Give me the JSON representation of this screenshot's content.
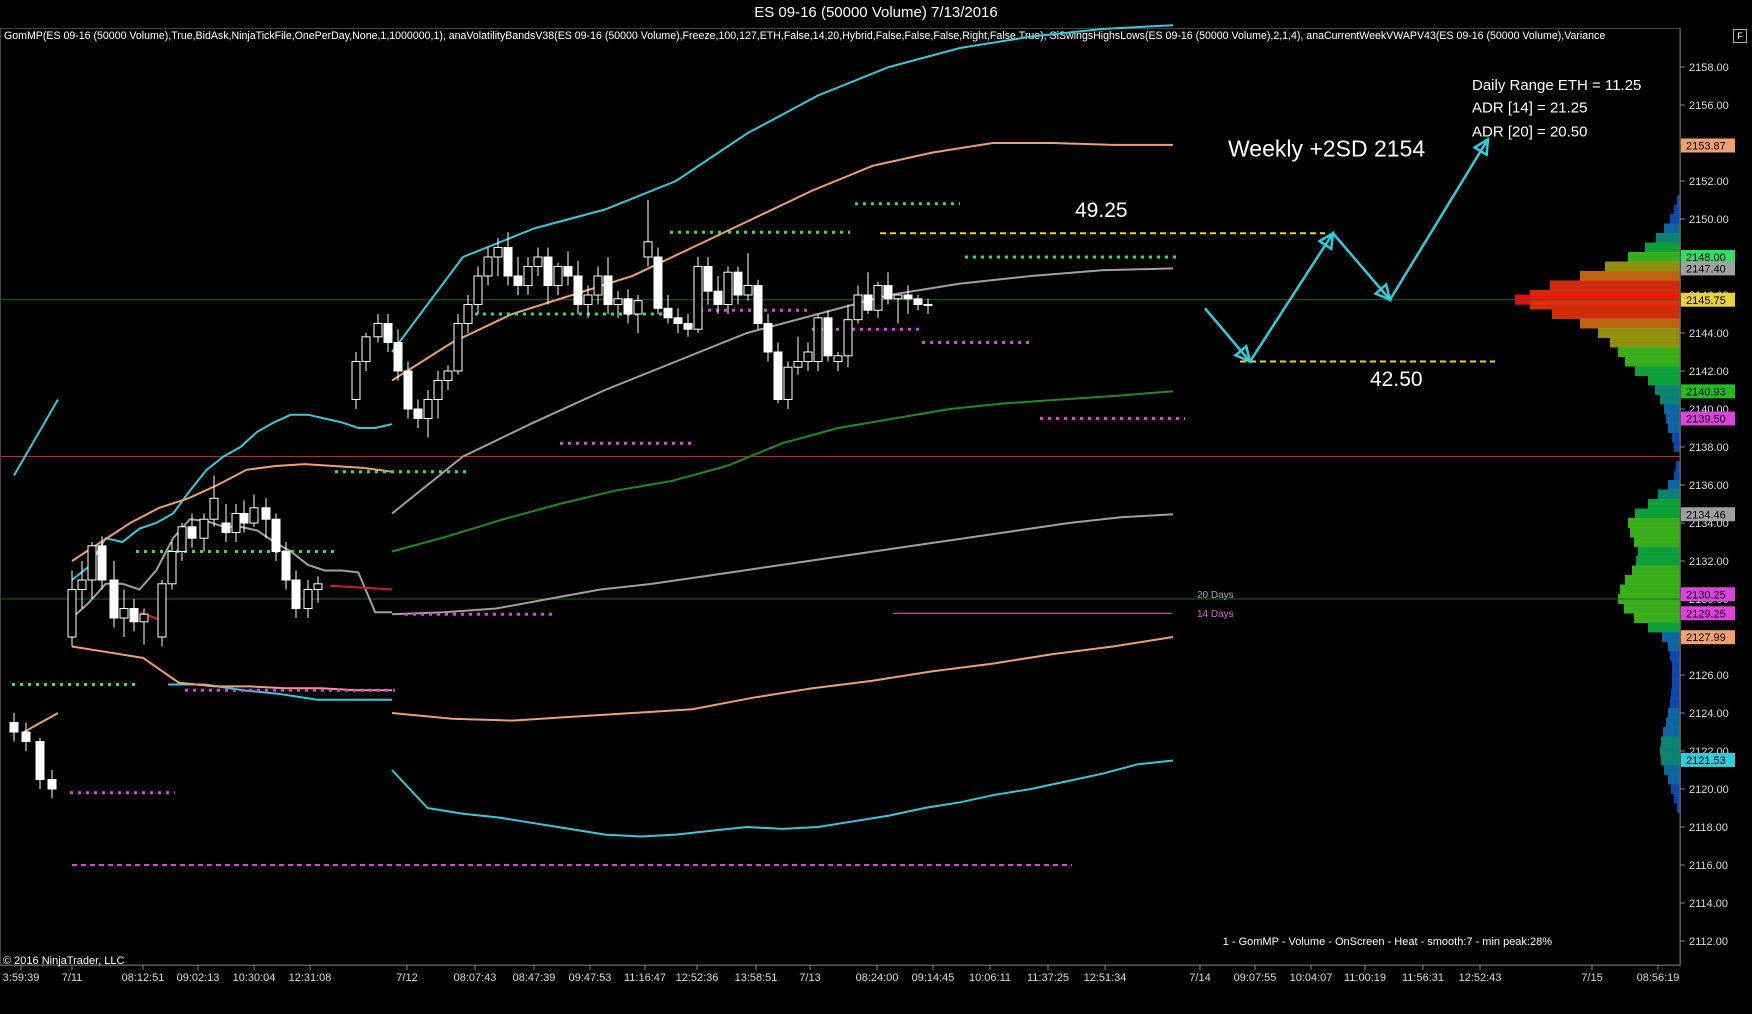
{
  "window": {
    "title": "ES 09-16 (50000 Volume)  7/13/2016"
  },
  "indicator_line": "GomMP(ES 09-16 (50000 Volume),True,BidAsk,NinjaTickFile,OnePerDay,None,1,1000000,1), anaVolatilityBandsV38(ES 09-16 (50000 Volume),Freeze,100,127,ETH,False,14,20,Hybrid,False,False,False,Right,False,True), SiSwingsHighsLows(ES 09-16 (50000 Volume),2,1,4), anaCurrentWeekVWAPV43(ES 09-16 (50000 Volume),Variance",
  "f_button": "F",
  "copyright": "© 2016 NinjaTrader, LLC",
  "footnote": "1 - GomMP - Volume - OnScreen - Heat - smooth:7 - min peak:28%",
  "colors": {
    "bg": "#000000",
    "cyan": "#33ccdd",
    "orange": "#f0a070",
    "gray": "#a0a0a0",
    "green": "#1e8c1e",
    "red_line": "#cc2222",
    "yellow": "#e8d040",
    "magenta": "#dd44dd"
  },
  "chart_data": {
    "type": "candlestick",
    "title": "ES 09-16 (50000 Volume)  7/13/2016",
    "ylim": [
      2111,
      2159.5
    ],
    "y_ticks": [
      "2112.00",
      "2114.00",
      "2116.00",
      "2118.00",
      "2120.00",
      "2122.00",
      "2124.00",
      "2126.00",
      "2128.00",
      "2130.00",
      "2132.00",
      "2134.00",
      "2136.00",
      "2138.00",
      "2140.00",
      "2142.00",
      "2144.00",
      "2146.00",
      "2148.00",
      "2150.00",
      "2152.00",
      "2154.00",
      "2156.00",
      "2158.00"
    ],
    "x_ticks": [
      "3:59:39",
      "7/11",
      "08:12:51",
      "09:02:13",
      "10:30:04",
      "12:31:08",
      "7/12",
      "08:07:43",
      "08:47:39",
      "09:47:53",
      "11:16:47",
      "12:52:36",
      "13:58:51",
      "7/13",
      "08:24:00",
      "09:14:45",
      "10:06:11",
      "11:37:25",
      "12:51:34",
      "7/14",
      "09:07:55",
      "10:04:07",
      "11:00:19",
      "11:56:31",
      "12:52:43",
      "7/15",
      "08:56:19"
    ],
    "price_labels": [
      {
        "text": "2153.87",
        "value": 2153.87,
        "color": "#f0a070"
      },
      {
        "text": "2148.00",
        "value": 2148.0,
        "color": "#33dd66"
      },
      {
        "text": "2147.40",
        "value": 2147.4,
        "color": "#a0a0a0"
      },
      {
        "text": "2145.75",
        "value": 2145.75,
        "color": "#e8d040"
      },
      {
        "text": "2140.93",
        "value": 2140.93,
        "color": "#22bb22"
      },
      {
        "text": "2139.50",
        "value": 2139.5,
        "color": "#dd44dd"
      },
      {
        "text": "2134.46",
        "value": 2134.46,
        "color": "#a0a0a0"
      },
      {
        "text": "2130.25",
        "value": 2130.25,
        "color": "#dd44dd"
      },
      {
        "text": "2129.25",
        "value": 2129.25,
        "color": "#dd44dd"
      },
      {
        "text": "2127.99",
        "value": 2127.99,
        "color": "#f0a070"
      },
      {
        "text": "2121.53",
        "value": 2121.53,
        "color": "#33ccdd"
      }
    ],
    "candles": [
      [
        2123.5,
        2124,
        2122.5,
        2123
      ],
      [
        2123,
        2123.5,
        2122,
        2122.5
      ],
      [
        2122.5,
        2122.7,
        2120,
        2120.5
      ],
      [
        2120.5,
        2121,
        2119.5,
        2120
      ],
      [
        2128,
        2131.5,
        2127.5,
        2130.5
      ],
      [
        2130.5,
        2132,
        2129.5,
        2131
      ],
      [
        2131,
        2133,
        2130,
        2132.8
      ],
      [
        2132.8,
        2133.3,
        2130.5,
        2131
      ],
      [
        2131,
        2132,
        2128.5,
        2129
      ],
      [
        2129,
        2130.5,
        2128,
        2129.5
      ],
      [
        2129.5,
        2130,
        2128.3,
        2128.8
      ],
      [
        2128.8,
        2129.5,
        2127.6,
        2129.2
      ],
      [
        2128,
        2131,
        2127.5,
        2130.8
      ],
      [
        2130.8,
        2133,
        2130.5,
        2132.5
      ],
      [
        2132.5,
        2134,
        2132,
        2133.8
      ],
      [
        2133.8,
        2134.5,
        2132.7,
        2133.2
      ],
      [
        2133.2,
        2134.5,
        2132.5,
        2134.2
      ],
      [
        2134.2,
        2136.5,
        2133.8,
        2135.3
      ],
      [
        2134,
        2135,
        2133,
        2133.5
      ],
      [
        2133.5,
        2135,
        2133,
        2134.5
      ],
      [
        2134.5,
        2135.2,
        2133.5,
        2134
      ],
      [
        2134,
        2135.5,
        2133.8,
        2134.8
      ],
      [
        2134.8,
        2135.3,
        2133.2,
        2134.2
      ],
      [
        2134.2,
        2134.5,
        2132,
        2132.5
      ],
      [
        2132.5,
        2133,
        2130.5,
        2131
      ],
      [
        2131,
        2131.5,
        2129,
        2129.5
      ],
      [
        2129.5,
        2131,
        2129,
        2130.5
      ],
      [
        2130.5,
        2131.2,
        2129.8,
        2130.8
      ],
      [
        2140.5,
        2143,
        2140,
        2142.5
      ],
      [
        2142.5,
        2144,
        2142,
        2143.8
      ],
      [
        2143.8,
        2145,
        2143.5,
        2144.5
      ],
      [
        2144.5,
        2145,
        2143,
        2143.5
      ],
      [
        2143.5,
        2144.2,
        2141.5,
        2142
      ],
      [
        2142,
        2142.5,
        2139.5,
        2140
      ],
      [
        2140,
        2140.5,
        2139,
        2139.5
      ],
      [
        2139.5,
        2141,
        2138.5,
        2140.5
      ],
      [
        2140.5,
        2142,
        2139.5,
        2141.5
      ],
      [
        2141.5,
        2142.3,
        2141,
        2142
      ],
      [
        2142,
        2145,
        2141.8,
        2144.5
      ],
      [
        2144.5,
        2146,
        2144,
        2145.5
      ],
      [
        2145.5,
        2147.5,
        2145,
        2147
      ],
      [
        2147,
        2148.5,
        2146.5,
        2148
      ],
      [
        2148,
        2149,
        2147,
        2148.5
      ],
      [
        2148.5,
        2149.3,
        2146.5,
        2147
      ],
      [
        2147,
        2148,
        2146,
        2146.5
      ],
      [
        2146.5,
        2148,
        2146,
        2147.5
      ],
      [
        2147.5,
        2148.5,
        2147,
        2148
      ],
      [
        2148,
        2148.5,
        2145.5,
        2146.5
      ],
      [
        2146.5,
        2147.7,
        2146,
        2147.5
      ],
      [
        2147.5,
        2148.3,
        2146.5,
        2147
      ],
      [
        2147,
        2147.8,
        2145,
        2145.5
      ],
      [
        2145.5,
        2146.5,
        2144.8,
        2146
      ],
      [
        2146,
        2147.5,
        2145.5,
        2147
      ],
      [
        2147,
        2148,
        2145,
        2145.5
      ],
      [
        2145.5,
        2146.2,
        2144.8,
        2145.8
      ],
      [
        2145.8,
        2146.3,
        2144.5,
        2145
      ],
      [
        2145,
        2146,
        2144,
        2145.7
      ],
      [
        2148,
        2151,
        2147.5,
        2148.8
      ],
      [
        2148,
        2148.5,
        2145,
        2145.3
      ],
      [
        2145.3,
        2146,
        2144.5,
        2144.8
      ],
      [
        2144.8,
        2145.3,
        2144,
        2144.5
      ],
      [
        2144.5,
        2145,
        2143.8,
        2144.2
      ],
      [
        2144.2,
        2148,
        2144,
        2147.5
      ],
      [
        2147.5,
        2148,
        2145.5,
        2146.2
      ],
      [
        2146.2,
        2147,
        2145,
        2145.5
      ],
      [
        2145.5,
        2147.5,
        2145,
        2147.2
      ],
      [
        2147.2,
        2147.5,
        2145.5,
        2146
      ],
      [
        2146,
        2148.2,
        2145.7,
        2146.5
      ],
      [
        2146.5,
        2146.8,
        2144.2,
        2144.5
      ],
      [
        2144.5,
        2145,
        2142.5,
        2143
      ],
      [
        2143,
        2143.5,
        2140.3,
        2140.5
      ],
      [
        2140.5,
        2142.5,
        2140,
        2142.2
      ],
      [
        2142.2,
        2143.8,
        2141.8,
        2142.5
      ],
      [
        2142.5,
        2143.5,
        2142,
        2143
      ],
      [
        2142.5,
        2145,
        2142,
        2144.8
      ],
      [
        2144.8,
        2145.2,
        2142.5,
        2142.8
      ],
      [
        2142.5,
        2143,
        2142,
        2142.8
      ],
      [
        2142.8,
        2145.5,
        2142.2,
        2144.7
      ],
      [
        2144.7,
        2146.5,
        2144.5,
        2146
      ],
      [
        2146,
        2147.2,
        2145,
        2145.2
      ],
      [
        2145.2,
        2146.7,
        2144.8,
        2146.5
      ],
      [
        2146.5,
        2147.2,
        2145.5,
        2145.8
      ],
      [
        2145.8,
        2146,
        2144.5,
        2146
      ],
      [
        2146,
        2146.5,
        2145,
        2145.8
      ],
      [
        2145.8,
        2146,
        2145.2,
        2145.5
      ],
      [
        2145.5,
        2145.8,
        2145,
        2145.5
      ]
    ],
    "candle_x": [
      14,
      26,
      40,
      52,
      72,
      82,
      92,
      102,
      114,
      124,
      134,
      144,
      162,
      172,
      182,
      192,
      204,
      214,
      226,
      236,
      244,
      254,
      266,
      276,
      286,
      296,
      308,
      318,
      356,
      366,
      378,
      388,
      398,
      408,
      418,
      428,
      438,
      448,
      458,
      468,
      478,
      488,
      498,
      508,
      518,
      528,
      538,
      548,
      558,
      568,
      578,
      588,
      598,
      608,
      618,
      628,
      638,
      648,
      658,
      668,
      678,
      688,
      698,
      708,
      718,
      728,
      738,
      748,
      758,
      768,
      778,
      788,
      798,
      808,
      818,
      828,
      838,
      848,
      858,
      868,
      878,
      888,
      898,
      908,
      918,
      928
    ],
    "annotations": [
      {
        "text": "Weekly +2SD 2154",
        "color": "#ffffff",
        "size": 23
      },
      {
        "text": "49.25",
        "color": "#ffffff",
        "size": 21
      },
      {
        "text": "42.50",
        "color": "#ffffff",
        "size": 21
      },
      {
        "text": "Daily Range ETH = 11.25",
        "color": "#ffffff",
        "size": 15
      },
      {
        "text": "ADR [14] = 21.25",
        "color": "#ffffff",
        "size": 15
      },
      {
        "text": "ADR [20] = 20.50",
        "color": "#ffffff",
        "size": 15
      },
      {
        "text": "20 Days",
        "color": "#aaaaaa",
        "size": 10
      },
      {
        "text": "14 Days",
        "color": "#dd66dd",
        "size": 10
      }
    ],
    "levels": {
      "red_line": 2137.5,
      "green_line": 2145.75,
      "green_line2": 2130.0,
      "yellow_high": 2149.25,
      "yellow_low": 2142.5,
      "magenta_dash": 2116.0,
      "vwap_14": 2129.25
    },
    "projection_path": [
      [
        2145.3
      ],
      [
        2142.5
      ],
      [
        2149.25
      ],
      [
        2145.75
      ],
      [
        2154.0
      ]
    ],
    "bands": {
      "cyan_upper": [
        [
          2136.5,
          2140.5
        ],
        [
          2131,
          2131.7,
          2133.2,
          2133,
          2133.7,
          2134,
          2134.5,
          2135.7,
          2136.8,
          2137.5,
          2138,
          2138.8,
          2139.3,
          2139.7,
          2139.7,
          2139.5,
          2139.3,
          2139,
          2139,
          2139.2
        ],
        [
          2143,
          2148,
          2149.5,
          2150.5,
          2152,
          2154.5,
          2156.5,
          2158,
          2159,
          2159.6,
          2160,
          2160.2
        ]
      ],
      "cyan_lower": [
        [
          2125.5,
          2125.5,
          2125.2,
          2125,
          2124.7,
          2124.7,
          2124.7
        ],
        [
          2121,
          2119,
          2118.7,
          2118.5,
          2118.2,
          2117.9,
          2117.6,
          2117.5,
          2117.6,
          2117.8,
          2118,
          2117.9,
          2118,
          2118.3,
          2118.6,
          2119,
          2119.3,
          2119.7,
          2120,
          2120.4,
          2120.8,
          2121.3,
          2121.5
        ]
      ],
      "orange_upper": [
        [
          2123,
          2124
        ],
        [
          2132,
          2133,
          2134,
          2134.8,
          2135.3,
          2136,
          2136.8,
          2137,
          2137.1,
          2137,
          2136.9,
          2136.7
        ],
        [
          2141.5,
          2143.5,
          2145,
          2146,
          2147,
          2148.5,
          2150,
          2151.5,
          2152.8,
          2153.5,
          2154,
          2154,
          2153.9,
          2153.9
        ]
      ],
      "orange_lower": [
        [
          2127.5,
          2127.2,
          2126.9,
          2125.6,
          2125.4,
          2125.4,
          2125.3,
          2125.3,
          2125.2,
          2125.2
        ],
        [
          2124,
          2123.7,
          2123.6,
          2123.8,
          2124,
          2124.2,
          2124.8,
          2125.3,
          2125.7,
          2126.2,
          2126.6,
          2127.1,
          2127.5,
          2128
        ]
      ],
      "gray_mid": [
        [
          2129,
          2129.8,
          2130.8,
          2130.8,
          2130.5,
          2131.5,
          2133.2,
          2134.2,
          2134.1,
          2133.8,
          2133.8,
          2133.6,
          2133,
          2132.5,
          2131.8,
          2131.5,
          2131.5,
          2131.4,
          2129.3,
          2129.3
        ],
        [
          2134.5,
          2137.5,
          2139.3,
          2141,
          2142.5,
          2144,
          2145,
          2146,
          2146.6,
          2147,
          2147.3,
          2147.4
        ]
      ],
      "gray_lower": [
        [
          2129.2,
          2129.3,
          2129.5,
          2130,
          2130.5,
          2130.8,
          2131.2,
          2131.6,
          2132,
          2132.4,
          2132.8,
          2133.2,
          2133.6,
          2134,
          2134.3,
          2134.46
        ]
      ],
      "green_mid": [
        [
          2132.5,
          2133.3,
          2134.2,
          2135,
          2135.7,
          2136.2,
          2137,
          2138.2,
          2139,
          2139.5,
          2140,
          2140.3,
          2140.5,
          2140.7,
          2140.93
        ]
      ]
    }
  }
}
